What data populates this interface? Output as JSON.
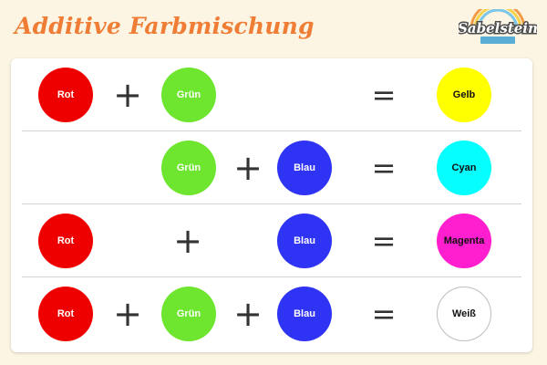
{
  "title": "Additive Farbmischung",
  "logo": {
    "name": "Sabelstein",
    "tagline": ""
  },
  "symbols": {
    "plus": "+",
    "equals": "="
  },
  "colors": {
    "rot": "#ef0000",
    "gruen": "#6ee52e",
    "blau": "#2f33f4",
    "gelb": "#ffff00",
    "cyan": "#05ffff",
    "magenta": "#ff1fce",
    "weiss": "#ffffff",
    "title": "#ef7d35",
    "background": "#fcf5e3"
  },
  "rows": [
    {
      "inputs": [
        "Rot",
        "Grün"
      ],
      "result": "Gelb"
    },
    {
      "inputs": [
        "Grün",
        "Blau"
      ],
      "result": "Cyan"
    },
    {
      "inputs": [
        "Rot",
        "Blau"
      ],
      "result": "Magenta"
    },
    {
      "inputs": [
        "Rot",
        "Grün",
        "Blau"
      ],
      "result": "Weiß"
    }
  ]
}
